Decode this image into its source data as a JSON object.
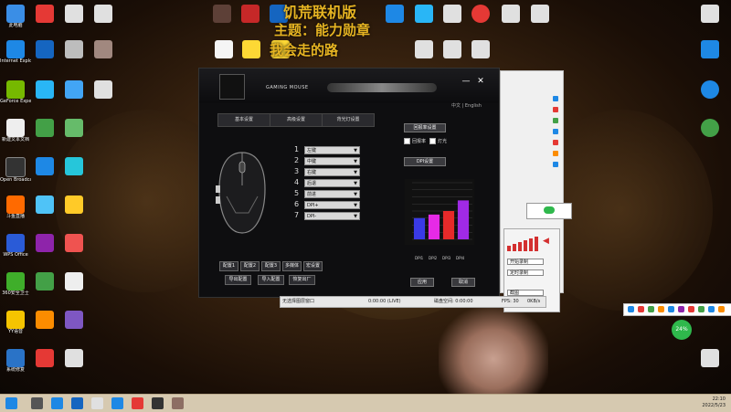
{
  "desktop_icons": [
    {
      "label": "此电脑",
      "color": "#3a8ee6"
    },
    {
      "label": "Internet Explorer",
      "color": "#1e88e5"
    },
    {
      "label": "GeForce Experience",
      "color": "#76b900"
    },
    {
      "label": "新建文本文档",
      "color": "#eeeeee"
    },
    {
      "label": "Open Broadcast",
      "color": "#333333"
    },
    {
      "label": "斗鱼直播",
      "color": "#ff6a00"
    },
    {
      "label": "WPS Office",
      "color": "#2a5bd7"
    },
    {
      "label": "360安全卫士",
      "color": "#3fae2a"
    },
    {
      "label": "YY语音",
      "color": "#f5c400"
    },
    {
      "label": "系统修复",
      "color": "#2a73c7"
    }
  ],
  "overlay": {
    "line1": "饥荒联机版",
    "line2": "主题：能力勋章",
    "line3": "我会走的路"
  },
  "main_window": {
    "header_title": "GAMING MOUSE",
    "minimize": "—",
    "close": "✕",
    "lang": "中文 | English",
    "tabs": [
      "基本设置",
      "高级设置",
      "背光灯设置"
    ],
    "buttons": [
      {
        "num": "1",
        "value": "左键"
      },
      {
        "num": "2",
        "value": "中键"
      },
      {
        "num": "3",
        "value": "右键"
      },
      {
        "num": "4",
        "value": "后退"
      },
      {
        "num": "5",
        "value": "前进"
      },
      {
        "num": "6",
        "value": "DPI+"
      },
      {
        "num": "7",
        "value": "DPI-"
      }
    ],
    "bottom_row1": [
      "配置1",
      "配置2",
      "配置3",
      "多媒体",
      "宏设置"
    ],
    "bottom_row2": [
      "导出配置",
      "导入配置",
      "恢复出厂"
    ],
    "right_top_btn": "回报率设置",
    "checks": [
      "回报率",
      "灯光"
    ],
    "dpi_btn": "DPI设置",
    "chart_labels": [
      "DPI1",
      "DPI2",
      "DPI3",
      "DPI4"
    ],
    "apply": "应用",
    "cancel": "取消"
  },
  "chart_data": {
    "type": "bar",
    "categories": [
      "DPI1",
      "DPI2",
      "DPI3",
      "DPI4"
    ],
    "values": [
      3,
      3.5,
      4,
      5.5
    ],
    "ylim": [
      0,
      8
    ],
    "colors": [
      "#3a3ae6",
      "#e62ae6",
      "#e62a2a",
      "#a02ae6"
    ]
  },
  "mini_window": {
    "rows": [
      "开始录制",
      "定时录制",
      "截图"
    ]
  },
  "status": {
    "a": "无选择图层窗口",
    "b": "0:00:00 (LIVE)",
    "c": "磁盘空间: 0:00:00",
    "d": "FPS: 30",
    "e": "0KB/s"
  },
  "tray": {
    "net": "24%"
  },
  "clock": {
    "time": "22:10",
    "date": "2022/5/23"
  }
}
